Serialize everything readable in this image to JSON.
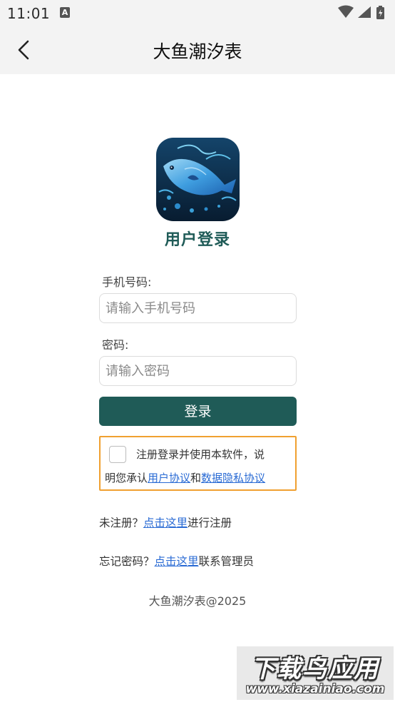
{
  "status_bar": {
    "time": "11:01",
    "notification_glyph": "A",
    "icons": [
      "wifi-icon",
      "cellular-signal-icon",
      "battery-charging-icon"
    ]
  },
  "title_bar": {
    "back_icon": "chevron-left-icon",
    "title": "大鱼潮汐表"
  },
  "logo": {
    "icon": "fish-app-logo",
    "background": "#0c2a46"
  },
  "login": {
    "heading": "用户登录",
    "phone_label": "手机号码:",
    "phone_placeholder": "请输入手机号码",
    "phone_value": "",
    "password_label": "密码:",
    "password_placeholder": "请输入密码",
    "password_value": "",
    "submit_label": "登录"
  },
  "agreement": {
    "checked": false,
    "line1": "注册登录并使用本软件，说",
    "line2_prefix": "明您承认",
    "user_agreement_link": "用户协议",
    "conjunction": "和",
    "privacy_link": "数据隐私协议"
  },
  "register_row": {
    "prefix": "未注册？",
    "link": "点击这里",
    "suffix": "进行注册"
  },
  "forgot_row": {
    "prefix": "忘记密码？",
    "link": "点击这里",
    "suffix": "联系管理员"
  },
  "footer": "大鱼潮汐表@2025",
  "watermark": {
    "title": "下载鸟应用",
    "url": "www.xiazainiao.com"
  },
  "colors": {
    "accent": "#1f5b57",
    "link": "#2a6bd4",
    "agreement_border": "#f0a030",
    "bar_background": "#f3f3f3"
  }
}
